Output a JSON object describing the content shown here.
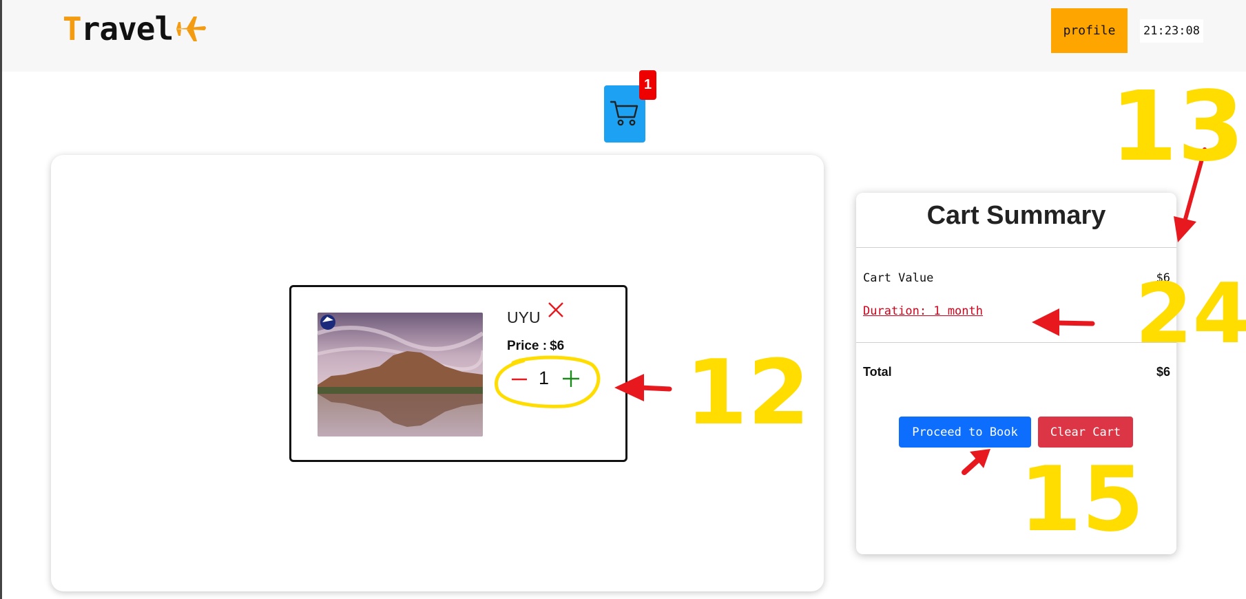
{
  "navbar": {
    "logo_first": "T",
    "logo_rest": "ravel",
    "profile_label": "profile",
    "clock": "21:23:08"
  },
  "cart": {
    "count": "1"
  },
  "cart_item": {
    "name": "UYU",
    "price_label": "Price :",
    "price_value": "$6",
    "quantity": "1"
  },
  "summary": {
    "title": "Cart Summary",
    "cart_value_label": "Cart Value",
    "cart_value": "$6",
    "duration": "Duration: 1 month",
    "total_label": "Total",
    "total_value": "$6",
    "proceed_label": "Proceed to Book",
    "clear_label": "Clear Cart"
  },
  "annotations": {
    "n12": "12",
    "n13": "13",
    "n24": "24",
    "n15": "15",
    "ink_color": "#ffdd00",
    "arrow_color": "#e8191e"
  },
  "colors": {
    "accent_orange": "#ffa500",
    "cart_blue": "#1da1f2",
    "badge_red": "#ee0000",
    "book_blue": "#0d6efd",
    "clear_red": "#dc3545"
  }
}
